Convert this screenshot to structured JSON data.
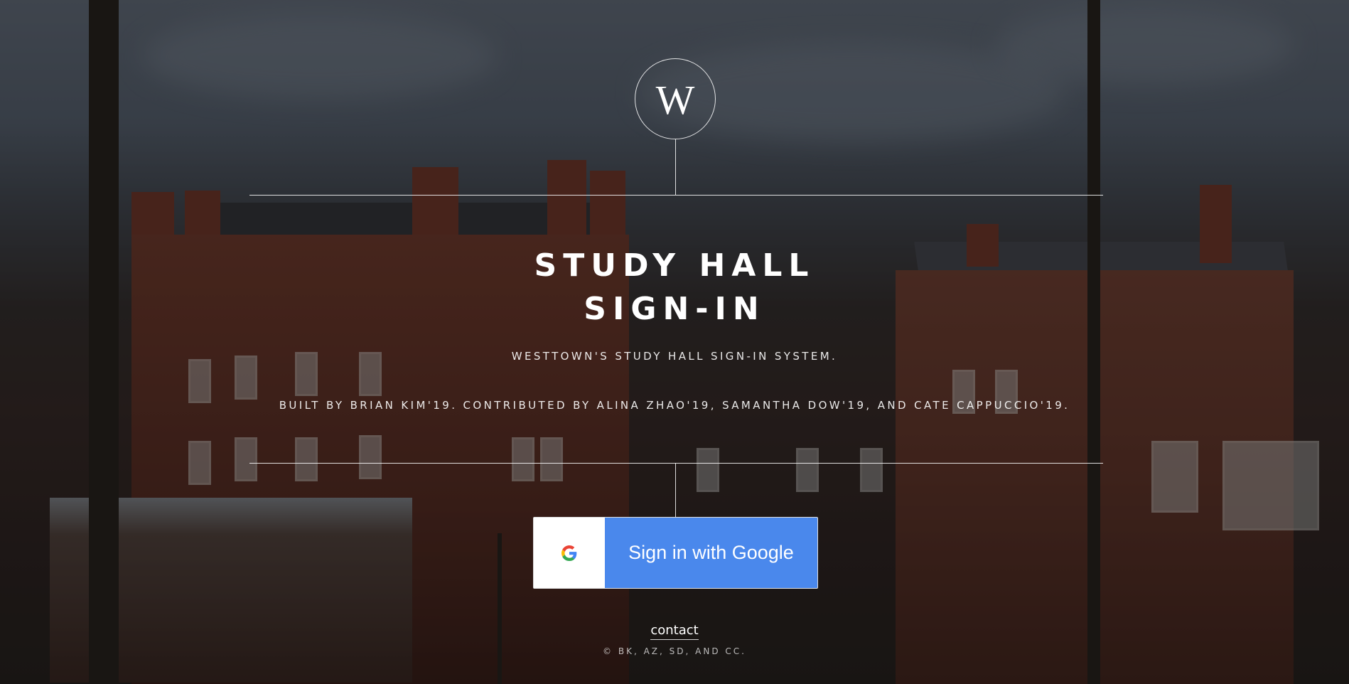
{
  "logo": {
    "letter": "W"
  },
  "title": {
    "line1": "STUDY HALL",
    "line2": "SIGN-IN"
  },
  "description": "WESTTOWN'S STUDY HALL SIGN-IN SYSTEM.",
  "credits": "BUILT BY BRIAN KIM'19. CONTRIBUTED BY ALINA ZHAO'19, SAMANTHA DOW'19, AND CATE CAPPUCCIO'19.",
  "google_button": {
    "label": "Sign in with Google",
    "icon": "google-g-icon"
  },
  "footer": {
    "contact_label": "contact",
    "copyright": "© BK, AZ, SD, AND CC."
  },
  "colors": {
    "google_blue": "#4a88ec",
    "overlay": "rgba(0,0,0,0.42)"
  }
}
